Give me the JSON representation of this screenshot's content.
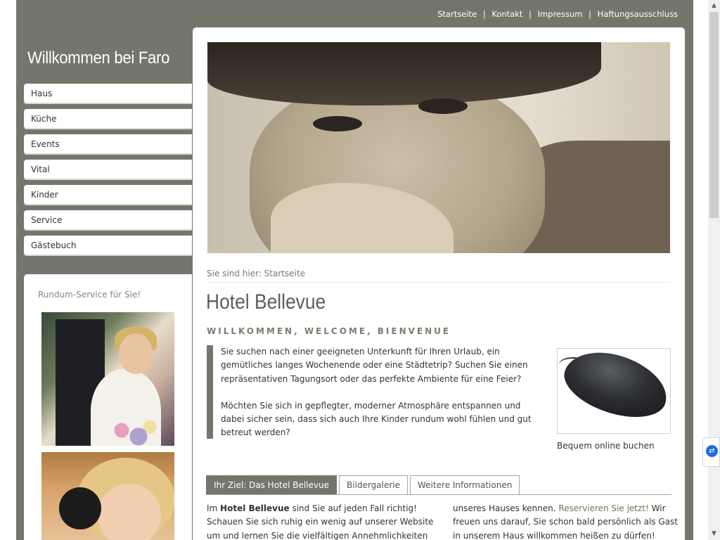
{
  "top_nav": {
    "items": [
      "Startseite",
      "Kontakt",
      "Impressum",
      "Haftungsausschluss"
    ],
    "separator": "|"
  },
  "sidebar": {
    "site_title": "Willkommen bei Faro",
    "nav": [
      "Haus",
      "Küche",
      "Events",
      "Vital",
      "Kinder",
      "Service",
      "Gästebuch"
    ],
    "box_heading": "Rundum-Service für Sie!"
  },
  "main": {
    "breadcrumb": "Sie sind hier: Startseite",
    "title": "Hotel Bellevue",
    "subtitle": "WILLKOMMEN, WELCOME, BIENVENUE",
    "intro_p1": "Sie suchen nach einer geeigneten Unterkunft für Ihren Urlaub, ein gemütliches langes Wochenende oder eine Städtetrip? Suchen Sie einen repräsentativen Tagungsort oder das perfekte Ambiente für eine Feier?",
    "intro_p2": "Möchten Sie sich in gepflegter, moderner Atmosphäre entspannen und dabei sicher sein, dass sich auch Ihre Kinder rundum wohl fühlen und gut betreut werden?",
    "image_caption": "Bequem online buchen",
    "tabs": [
      "Ihr Ziel: Das Hotel Bellevue",
      "Bildergalerie",
      "Weitere Informationen"
    ],
    "col1_prefix": "Im ",
    "col1_bold": "Hotel Bellevue",
    "col1_text": " sind Sie auf jeden Fall richtig! Schauen Sie sich ruhig ein wenig auf unserer Website um und lernen Sie die vielfältigen Annehmlichkeiten und",
    "col2_text1": "unseres Hauses kennen. ",
    "col2_link": "Reservieren Sie jetzt!",
    "col2_text2": " Wir freuen uns darauf, Sie schon bald persönlich als Gast in unserem Haus willkommen heißen zu dürfen!"
  },
  "colors": {
    "frame": "#76756b",
    "accent_text": "#7f7b6e",
    "link": "#7a7050"
  },
  "icons": {
    "teamviewer": "teamviewer-icon",
    "scroll_up": "chevron-up-icon",
    "scroll_down": "chevron-down-icon"
  }
}
